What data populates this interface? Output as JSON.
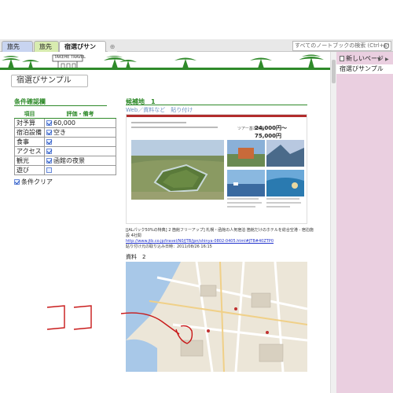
{
  "tabs": [
    {
      "label": "旅先",
      "number": "1"
    },
    {
      "label": "旅先",
      "number": "2"
    },
    {
      "label": "宿選びサンプル"
    }
  ],
  "search": {
    "placeholder": "すべてのノートブックの検索 (Ctrl+E)"
  },
  "banner": {
    "sign_text": "TAKEHE TRAVEL"
  },
  "page": {
    "title": "宿選びサンプル"
  },
  "conditions": {
    "heading": "条件確認欄",
    "col_item": "項目",
    "col_eval": "評価・備考",
    "rows": [
      {
        "item": "対予算",
        "checked": true,
        "note": "60,000"
      },
      {
        "item": "宿泊設備",
        "checked": true,
        "note": "空き"
      },
      {
        "item": "食事",
        "checked": true,
        "note": ""
      },
      {
        "item": "アクセス",
        "checked": true,
        "note": ""
      },
      {
        "item": "観光",
        "checked": true,
        "note": "函館の夜景"
      },
      {
        "item": "遊び",
        "checked": false,
        "note": ""
      }
    ],
    "clear_label": "条件クリア",
    "clear_checked": true
  },
  "candidate": {
    "heading": "候補地　1",
    "subtitle": "Web／資料など　貼り付け",
    "price_label": "ツアー基本料金：",
    "price": "24,000円～75,000円",
    "url_caption": "[JALパック50%の特典] 2 箇館フリーアップ] 札幌・函館の人気宿泊 箇館だけのホテルを総合空港 - 宿泊施設 4社間",
    "url": "http://www.jtb.co.jp/travel/N0/JTB/jpn/shinya-0802-0405.html#JTB#40ZTP0",
    "clip_date": "貼り付け元の取り込み日時：2011/08/26 16:15"
  },
  "material": {
    "label": "資料　2"
  },
  "sidebar": {
    "new_page": "新しいページ",
    "page_item": "宿選びサンプル"
  },
  "annotation": {
    "handwriting": "ココ"
  },
  "colors": {
    "accent_green": "#2f8a2a",
    "sidebar_pink": "#eacfe0",
    "ink_red": "#c81818"
  }
}
